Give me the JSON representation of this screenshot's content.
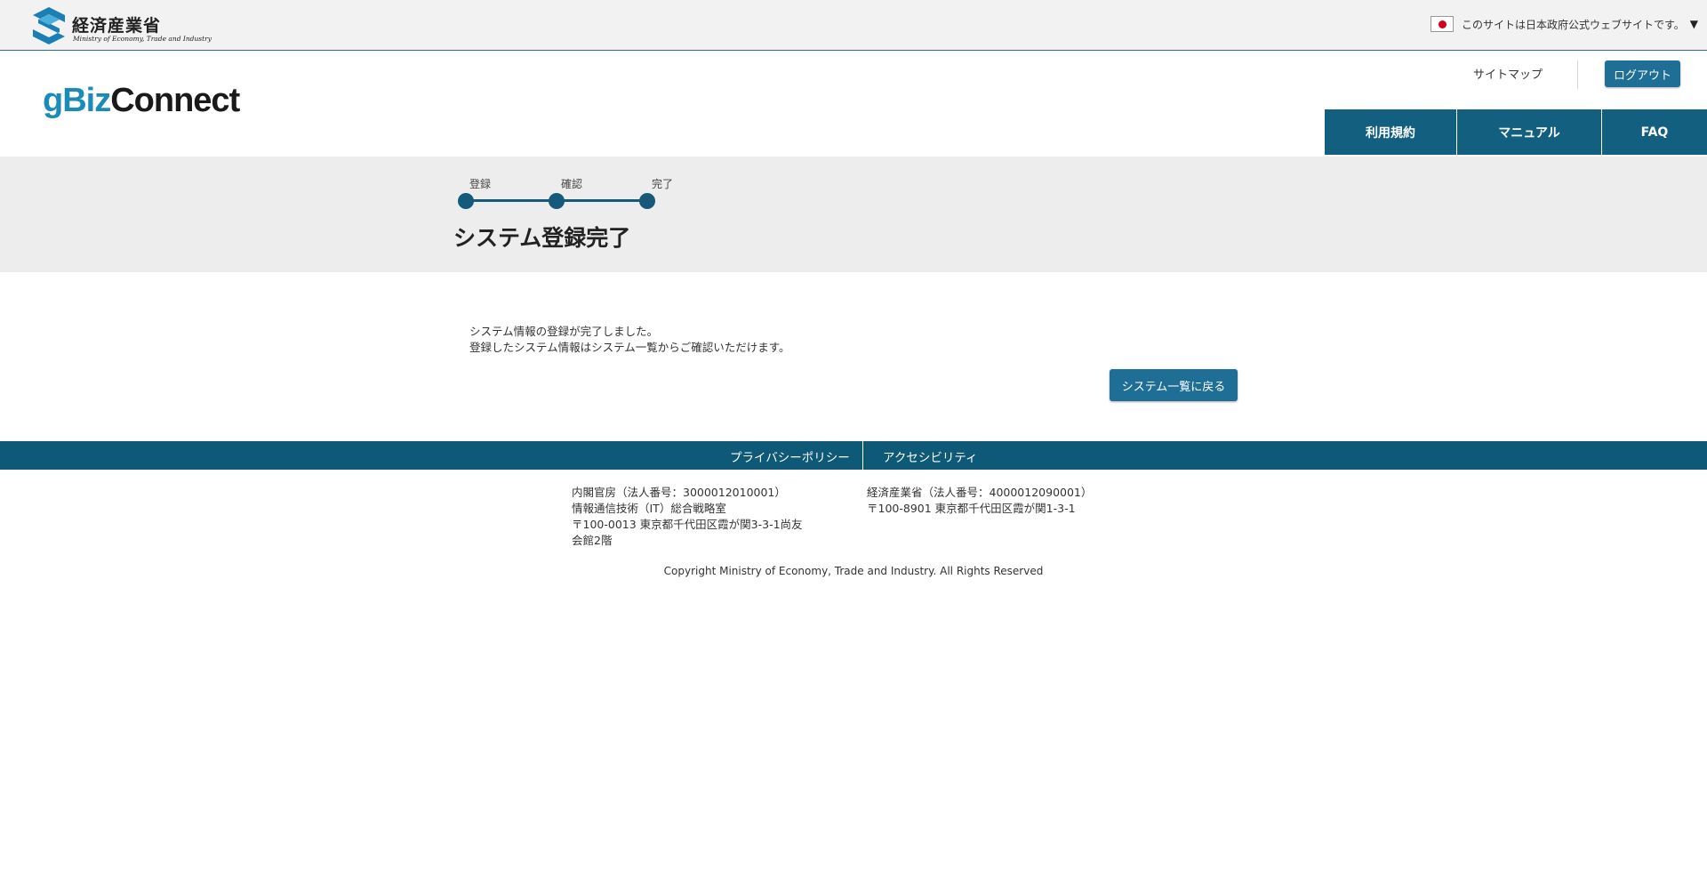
{
  "gov_bar": {
    "ministry_name": "経済産業省",
    "ministry_name_en": "Ministry of Economy, Trade and Industry",
    "notice": "このサイトは日本政府公式ウェブサイトです。",
    "notice_caret": "▼",
    "flag_icon": "japan-flag-icon"
  },
  "header": {
    "brand_part1": "gBiz",
    "brand_part2": "Connect",
    "sitemap": "サイトマップ",
    "logout": "ログアウト",
    "nav": [
      {
        "label": "利用規約"
      },
      {
        "label": "マニュアル"
      },
      {
        "label": "FAQ"
      }
    ]
  },
  "progress": {
    "steps": [
      {
        "label": "登録"
      },
      {
        "label": "確認"
      },
      {
        "label": "完了"
      }
    ]
  },
  "page_title": "システム登録完了",
  "main": {
    "message_line1": "システム情報の登録が完了しました。",
    "message_line2": "登録したシステム情報はシステム一覧からご確認いただけます。",
    "back_button": "システム一覧に戻る"
  },
  "footer": {
    "nav": [
      {
        "label": "プライバシーポリシー"
      },
      {
        "label": "アクセシビリティ"
      }
    ],
    "address_left": [
      "内閣官房（法人番号：3000012010001）",
      "情報通信技術（IT）総合戦略室",
      "〒100-0013 東京都千代田区霞が関3-3-1尚友",
      "会館2階"
    ],
    "address_right": [
      "経済産業省（法人番号：4000012090001）",
      "〒100-8901 東京都千代田区霞が関1-3-1"
    ],
    "copyright": "Copyright Ministry of Economy, Trade and Industry. All Rights Reserved"
  },
  "colors": {
    "primary": "#135f80",
    "button": "#1f6e96",
    "brand_accent": "#1b8cb8",
    "band_bg": "#ededed",
    "gov_bar_bg": "#f2f2f2"
  }
}
